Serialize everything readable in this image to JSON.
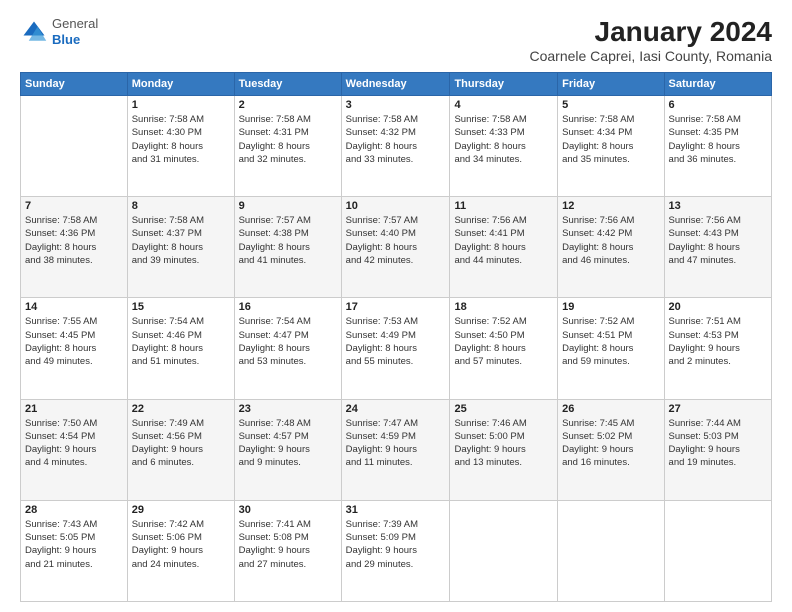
{
  "logo": {
    "general": "General",
    "blue": "Blue"
  },
  "title": "January 2024",
  "subtitle": "Coarnele Caprei, Iasi County, Romania",
  "days_header": [
    "Sunday",
    "Monday",
    "Tuesday",
    "Wednesday",
    "Thursday",
    "Friday",
    "Saturday"
  ],
  "weeks": [
    [
      {
        "day": "",
        "info": ""
      },
      {
        "day": "1",
        "info": "Sunrise: 7:58 AM\nSunset: 4:30 PM\nDaylight: 8 hours\nand 31 minutes."
      },
      {
        "day": "2",
        "info": "Sunrise: 7:58 AM\nSunset: 4:31 PM\nDaylight: 8 hours\nand 32 minutes."
      },
      {
        "day": "3",
        "info": "Sunrise: 7:58 AM\nSunset: 4:32 PM\nDaylight: 8 hours\nand 33 minutes."
      },
      {
        "day": "4",
        "info": "Sunrise: 7:58 AM\nSunset: 4:33 PM\nDaylight: 8 hours\nand 34 minutes."
      },
      {
        "day": "5",
        "info": "Sunrise: 7:58 AM\nSunset: 4:34 PM\nDaylight: 8 hours\nand 35 minutes."
      },
      {
        "day": "6",
        "info": "Sunrise: 7:58 AM\nSunset: 4:35 PM\nDaylight: 8 hours\nand 36 minutes."
      }
    ],
    [
      {
        "day": "7",
        "info": "Sunrise: 7:58 AM\nSunset: 4:36 PM\nDaylight: 8 hours\nand 38 minutes."
      },
      {
        "day": "8",
        "info": "Sunrise: 7:58 AM\nSunset: 4:37 PM\nDaylight: 8 hours\nand 39 minutes."
      },
      {
        "day": "9",
        "info": "Sunrise: 7:57 AM\nSunset: 4:38 PM\nDaylight: 8 hours\nand 41 minutes."
      },
      {
        "day": "10",
        "info": "Sunrise: 7:57 AM\nSunset: 4:40 PM\nDaylight: 8 hours\nand 42 minutes."
      },
      {
        "day": "11",
        "info": "Sunrise: 7:56 AM\nSunset: 4:41 PM\nDaylight: 8 hours\nand 44 minutes."
      },
      {
        "day": "12",
        "info": "Sunrise: 7:56 AM\nSunset: 4:42 PM\nDaylight: 8 hours\nand 46 minutes."
      },
      {
        "day": "13",
        "info": "Sunrise: 7:56 AM\nSunset: 4:43 PM\nDaylight: 8 hours\nand 47 minutes."
      }
    ],
    [
      {
        "day": "14",
        "info": "Sunrise: 7:55 AM\nSunset: 4:45 PM\nDaylight: 8 hours\nand 49 minutes."
      },
      {
        "day": "15",
        "info": "Sunrise: 7:54 AM\nSunset: 4:46 PM\nDaylight: 8 hours\nand 51 minutes."
      },
      {
        "day": "16",
        "info": "Sunrise: 7:54 AM\nSunset: 4:47 PM\nDaylight: 8 hours\nand 53 minutes."
      },
      {
        "day": "17",
        "info": "Sunrise: 7:53 AM\nSunset: 4:49 PM\nDaylight: 8 hours\nand 55 minutes."
      },
      {
        "day": "18",
        "info": "Sunrise: 7:52 AM\nSunset: 4:50 PM\nDaylight: 8 hours\nand 57 minutes."
      },
      {
        "day": "19",
        "info": "Sunrise: 7:52 AM\nSunset: 4:51 PM\nDaylight: 8 hours\nand 59 minutes."
      },
      {
        "day": "20",
        "info": "Sunrise: 7:51 AM\nSunset: 4:53 PM\nDaylight: 9 hours\nand 2 minutes."
      }
    ],
    [
      {
        "day": "21",
        "info": "Sunrise: 7:50 AM\nSunset: 4:54 PM\nDaylight: 9 hours\nand 4 minutes."
      },
      {
        "day": "22",
        "info": "Sunrise: 7:49 AM\nSunset: 4:56 PM\nDaylight: 9 hours\nand 6 minutes."
      },
      {
        "day": "23",
        "info": "Sunrise: 7:48 AM\nSunset: 4:57 PM\nDaylight: 9 hours\nand 9 minutes."
      },
      {
        "day": "24",
        "info": "Sunrise: 7:47 AM\nSunset: 4:59 PM\nDaylight: 9 hours\nand 11 minutes."
      },
      {
        "day": "25",
        "info": "Sunrise: 7:46 AM\nSunset: 5:00 PM\nDaylight: 9 hours\nand 13 minutes."
      },
      {
        "day": "26",
        "info": "Sunrise: 7:45 AM\nSunset: 5:02 PM\nDaylight: 9 hours\nand 16 minutes."
      },
      {
        "day": "27",
        "info": "Sunrise: 7:44 AM\nSunset: 5:03 PM\nDaylight: 9 hours\nand 19 minutes."
      }
    ],
    [
      {
        "day": "28",
        "info": "Sunrise: 7:43 AM\nSunset: 5:05 PM\nDaylight: 9 hours\nand 21 minutes."
      },
      {
        "day": "29",
        "info": "Sunrise: 7:42 AM\nSunset: 5:06 PM\nDaylight: 9 hours\nand 24 minutes."
      },
      {
        "day": "30",
        "info": "Sunrise: 7:41 AM\nSunset: 5:08 PM\nDaylight: 9 hours\nand 27 minutes."
      },
      {
        "day": "31",
        "info": "Sunrise: 7:39 AM\nSunset: 5:09 PM\nDaylight: 9 hours\nand 29 minutes."
      },
      {
        "day": "",
        "info": ""
      },
      {
        "day": "",
        "info": ""
      },
      {
        "day": "",
        "info": ""
      }
    ]
  ]
}
